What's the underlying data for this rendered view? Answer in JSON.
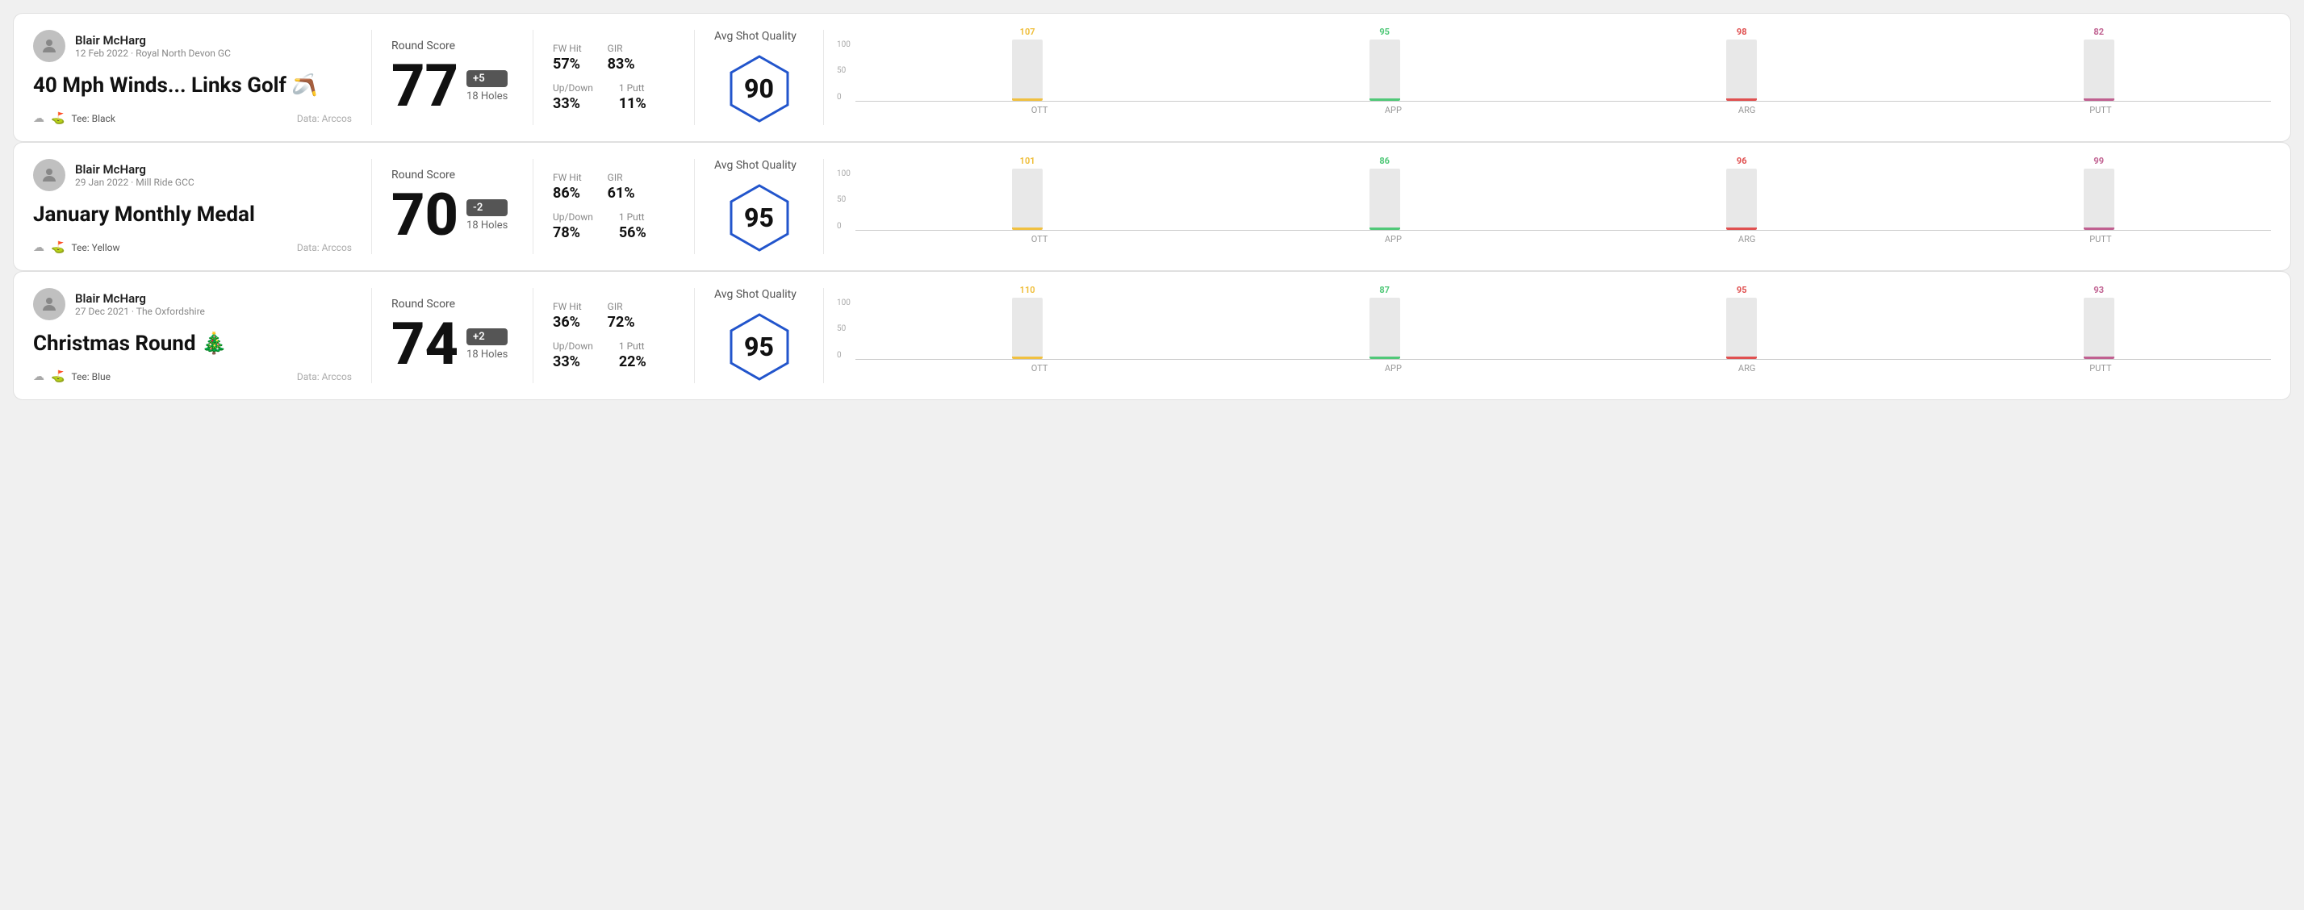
{
  "rounds": [
    {
      "id": "round-1",
      "user": {
        "name": "Blair McHarg",
        "meta": "12 Feb 2022 · Royal North Devon GC"
      },
      "title": "40 Mph Winds... Links Golf 🪃",
      "tee": "Black",
      "data_source": "Data: Arccos",
      "score": {
        "label": "Round Score",
        "number": "77",
        "badge": "+5",
        "badge_type": "over",
        "holes": "18 Holes"
      },
      "stats": {
        "fw_hit_label": "FW Hit",
        "fw_hit_value": "57%",
        "gir_label": "GIR",
        "gir_value": "83%",
        "updown_label": "Up/Down",
        "updown_value": "33%",
        "oneputt_label": "1 Putt",
        "oneputt_value": "11%"
      },
      "quality": {
        "label": "Avg Shot Quality",
        "score": "90"
      },
      "chart": {
        "y_labels": [
          "100",
          "50",
          "0"
        ],
        "bars": [
          {
            "label": "OTT",
            "value": 107,
            "top_val": "107",
            "color": "#f0c040",
            "height_pct": 80
          },
          {
            "label": "APP",
            "value": 95,
            "top_val": "95",
            "color": "#50c878",
            "height_pct": 70
          },
          {
            "label": "ARG",
            "value": 98,
            "top_val": "98",
            "color": "#e05050",
            "height_pct": 73
          },
          {
            "label": "PUTT",
            "value": 82,
            "top_val": "82",
            "color": "#c06090",
            "height_pct": 60
          }
        ]
      }
    },
    {
      "id": "round-2",
      "user": {
        "name": "Blair McHarg",
        "meta": "29 Jan 2022 · Mill Ride GCC"
      },
      "title": "January Monthly Medal",
      "tee": "Yellow",
      "data_source": "Data: Arccos",
      "score": {
        "label": "Round Score",
        "number": "70",
        "badge": "-2",
        "badge_type": "under",
        "holes": "18 Holes"
      },
      "stats": {
        "fw_hit_label": "FW Hit",
        "fw_hit_value": "86%",
        "gir_label": "GIR",
        "gir_value": "61%",
        "updown_label": "Up/Down",
        "updown_value": "78%",
        "oneputt_label": "1 Putt",
        "oneputt_value": "56%"
      },
      "quality": {
        "label": "Avg Shot Quality",
        "score": "95"
      },
      "chart": {
        "y_labels": [
          "100",
          "50",
          "0"
        ],
        "bars": [
          {
            "label": "OTT",
            "value": 101,
            "top_val": "101",
            "color": "#f0c040",
            "height_pct": 78
          },
          {
            "label": "APP",
            "value": 86,
            "top_val": "86",
            "color": "#50c878",
            "height_pct": 65
          },
          {
            "label": "ARG",
            "value": 96,
            "top_val": "96",
            "color": "#e05050",
            "height_pct": 73
          },
          {
            "label": "PUTT",
            "value": 99,
            "top_val": "99",
            "color": "#c06090",
            "height_pct": 76
          }
        ]
      }
    },
    {
      "id": "round-3",
      "user": {
        "name": "Blair McHarg",
        "meta": "27 Dec 2021 · The Oxfordshire"
      },
      "title": "Christmas Round 🎄",
      "tee": "Blue",
      "data_source": "Data: Arccos",
      "score": {
        "label": "Round Score",
        "number": "74",
        "badge": "+2",
        "badge_type": "over",
        "holes": "18 Holes"
      },
      "stats": {
        "fw_hit_label": "FW Hit",
        "fw_hit_value": "36%",
        "gir_label": "GIR",
        "gir_value": "72%",
        "updown_label": "Up/Down",
        "updown_value": "33%",
        "oneputt_label": "1 Putt",
        "oneputt_value": "22%"
      },
      "quality": {
        "label": "Avg Shot Quality",
        "score": "95"
      },
      "chart": {
        "y_labels": [
          "100",
          "50",
          "0"
        ],
        "bars": [
          {
            "label": "OTT",
            "value": 110,
            "top_val": "110",
            "color": "#f0c040",
            "height_pct": 83
          },
          {
            "label": "APP",
            "value": 87,
            "top_val": "87",
            "color": "#50c878",
            "height_pct": 65
          },
          {
            "label": "ARG",
            "value": 95,
            "top_val": "95",
            "color": "#e05050",
            "height_pct": 72
          },
          {
            "label": "PUTT",
            "value": 93,
            "top_val": "93",
            "color": "#c06090",
            "height_pct": 71
          }
        ]
      }
    }
  ]
}
